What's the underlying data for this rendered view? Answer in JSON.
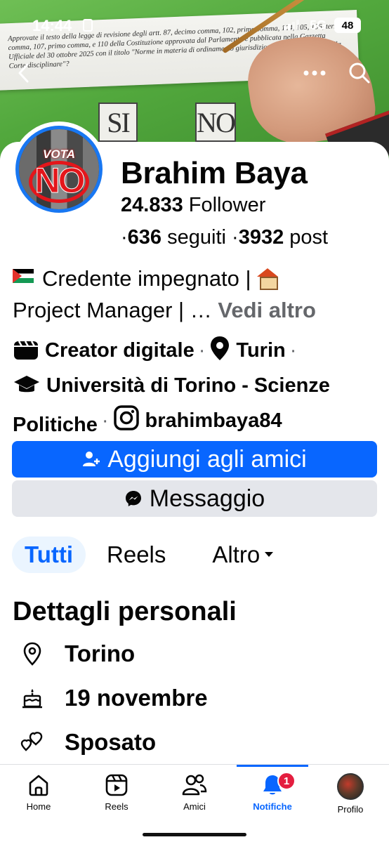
{
  "status_bar": {
    "time": "14:44",
    "network": "5G",
    "battery": "48"
  },
  "cover": {
    "ballot_text": "Approvate il testo della legge di revisione degli artt. 87, decimo comma, 102, primo comma, 104, 105, 106, terzo comma, 107, primo comma, e 110 della Costituzione approvata dal Parlamento e pubblicata nella Gazzetta Ufficiale del 30 ottobre 2025 con il titolo \"Norme in materia di ordinamento giurisdizionale e di istituzione della Corte disciplinare\"?",
    "option_yes": "SI",
    "option_no": "NO"
  },
  "avatar": {
    "top_text": "VOTA",
    "main_text": "NO"
  },
  "profile": {
    "name": "Brahim Baya",
    "followers_count": "24.833",
    "followers_label": "Follower",
    "following_count": "636",
    "following_label": "seguiti",
    "posts_count": "3932",
    "posts_label": "post",
    "bio": "Credente impegnato | ",
    "bio_rest": "Project Manager | …",
    "see_more": "Vedi altro",
    "category": "Creator digitale",
    "city": "Turin",
    "education": "Università di Torino - Scienze Politiche",
    "instagram": "brahimbaya84"
  },
  "actions": {
    "add_friend": "Aggiungi agli amici",
    "message": "Messaggio"
  },
  "tabs": [
    {
      "label": "Tutti"
    },
    {
      "label": "Reels"
    },
    {
      "label": "Altro"
    }
  ],
  "details": {
    "title": "Dettagli personali",
    "location": "Torino",
    "birthday": "19 novembre",
    "relationship": "Sposato"
  },
  "bottom_nav": {
    "home": "Home",
    "reels": "Reels",
    "friends": "Amici",
    "notifications": "Notifiche",
    "notifications_badge": "1",
    "profile": "Profilo"
  },
  "colors": {
    "accent": "#0866ff",
    "badge": "#e41e3f",
    "secondary_button": "#e4e6eb"
  }
}
